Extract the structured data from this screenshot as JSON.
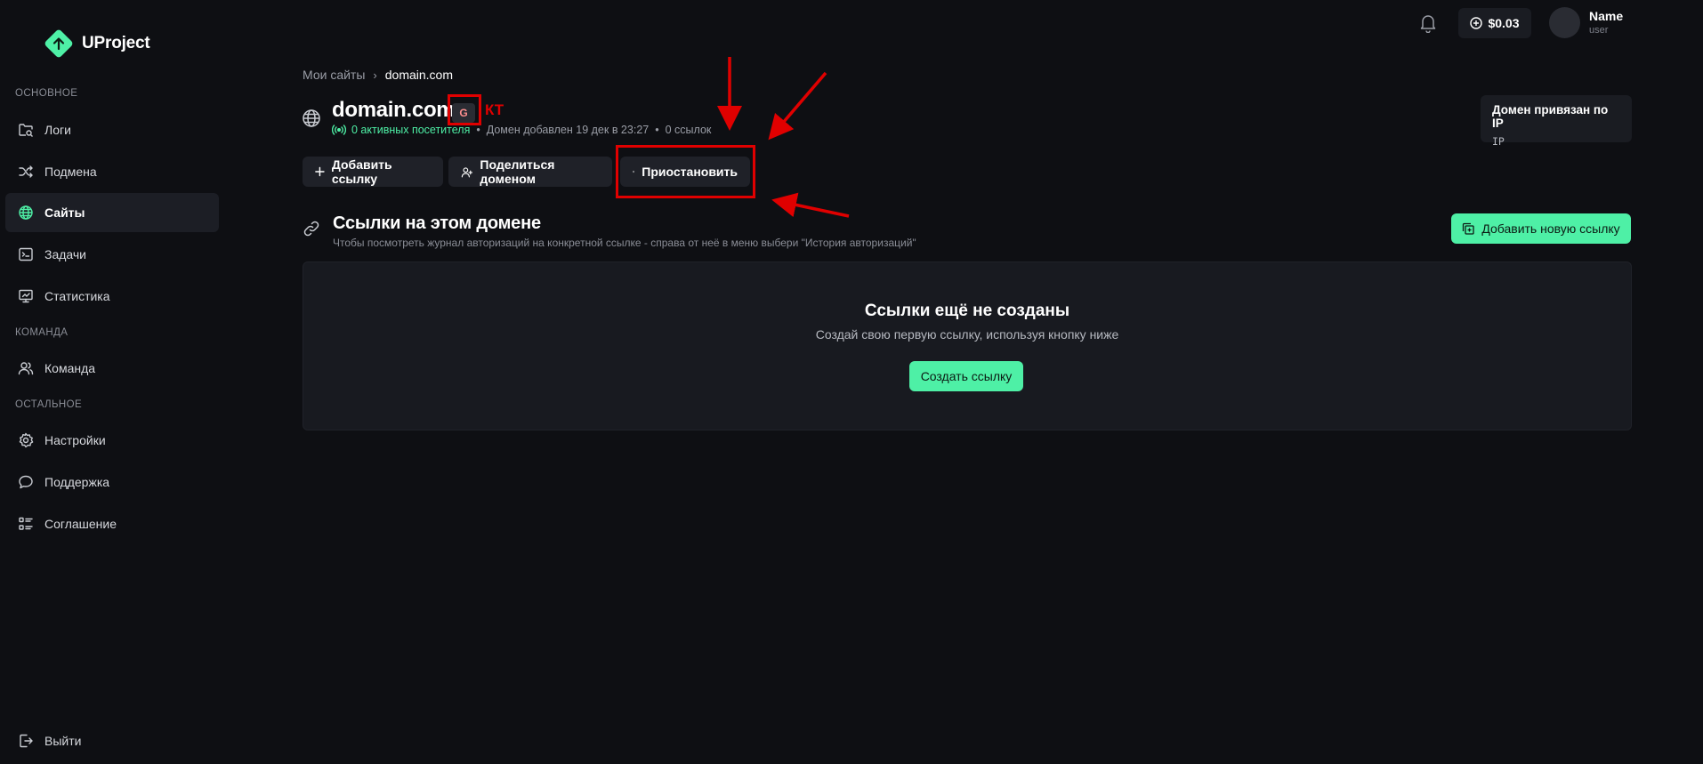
{
  "app": {
    "name": "UProject"
  },
  "colors": {
    "accent": "#4ef0a6",
    "annotation": "#e00000",
    "background": "#0e0f13",
    "card": "#181a20"
  },
  "sidebar": {
    "sections": [
      {
        "label": "Основное",
        "items": [
          {
            "label": "Логи",
            "icon": "folder-search-icon"
          },
          {
            "label": "Подмена",
            "icon": "shuffle-icon"
          },
          {
            "label": "Сайты",
            "icon": "globe-icon",
            "active": true
          },
          {
            "label": "Задачи",
            "icon": "terminal-icon"
          },
          {
            "label": "Статистика",
            "icon": "monitor-chart-icon"
          }
        ]
      },
      {
        "label": "Команда",
        "items": [
          {
            "label": "Команда",
            "icon": "users-icon"
          }
        ]
      },
      {
        "label": "Остальное",
        "items": [
          {
            "label": "Настройки",
            "icon": "gear-icon"
          },
          {
            "label": "Поддержка",
            "icon": "chat-bubble-icon"
          },
          {
            "label": "Соглашение",
            "icon": "list-icon"
          }
        ]
      }
    ],
    "logout": {
      "label": "Выйти",
      "icon": "logout-icon"
    }
  },
  "topbar": {
    "balance": "$0.03",
    "user": {
      "name": "Name",
      "role": "user"
    }
  },
  "breadcrumb": {
    "parent": "Мои сайты",
    "separator": "›",
    "current": "domain.com"
  },
  "domain": {
    "title": "domain.com",
    "badge": "G",
    "annotation_label": "КТ",
    "active_visitors": "0 активных посетителя",
    "added": "Домен добавлен 19 дек в 23:27",
    "links_count": "0 ссылок",
    "ip_card": {
      "title": "Домен привязан по IP",
      "value": "IP"
    }
  },
  "actions": {
    "add_link": "Добавить ссылку",
    "share_domain": "Поделиться доменом",
    "pause": "Приостановить"
  },
  "links": {
    "title": "Ссылки на этом домене",
    "subtitle": "Чтобы посмотреть журнал авторизаций на конкретной ссылке - справа от неё в меню выбери \"История авторизаций\"",
    "add_new": "Добавить новую ссылку",
    "empty": {
      "title": "Ссылки ещё не созданы",
      "subtitle": "Создай свою первую ссылку, используя кнопку ниже",
      "create_button": "Создать ссылку"
    }
  }
}
